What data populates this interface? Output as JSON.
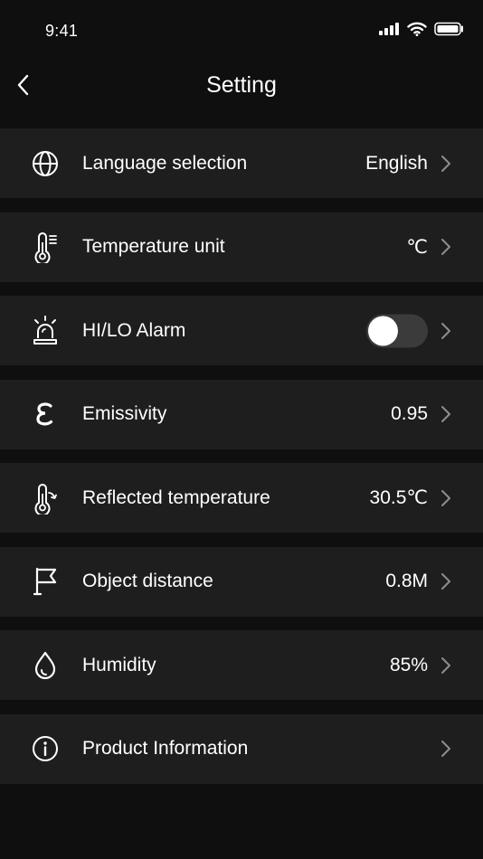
{
  "status_bar": {
    "time": "9:41",
    "icons": [
      "cellular-signal-icon",
      "wifi-icon",
      "battery-icon"
    ]
  },
  "header": {
    "title": "Setting",
    "back_icon": "chevron-left-icon"
  },
  "settings": [
    {
      "key": "language",
      "icon": "globe-icon",
      "label": "Language selection",
      "value": "English"
    },
    {
      "key": "temperature-unit",
      "icon": "thermometer-icon",
      "label": "Temperature unit",
      "value": "℃"
    },
    {
      "key": "alarm",
      "icon": "alarm-siren-icon",
      "label": "HI/LO Alarm",
      "toggle_on": false
    },
    {
      "key": "emissivity",
      "icon": "epsilon-icon",
      "label": "Emissivity",
      "value": "0.95"
    },
    {
      "key": "reflected-temperature",
      "icon": "thermometer-reflect-icon",
      "label": "Reflected temperature",
      "value": "30.5℃"
    },
    {
      "key": "object-distance",
      "icon": "flag-icon",
      "label": "Object distance",
      "value": "0.8M"
    },
    {
      "key": "humidity",
      "icon": "droplet-icon",
      "label": "Humidity",
      "value": "85%"
    },
    {
      "key": "product-information",
      "icon": "info-icon",
      "label": "Product Information",
      "value": ""
    }
  ],
  "colors": {
    "background": "#0f0f0f",
    "row_background": "#1e1e1e",
    "text": "#ffffff",
    "chevron": "#8e8e8e",
    "toggle_track": "#3b3b3b",
    "toggle_knob": "#ffffff"
  }
}
